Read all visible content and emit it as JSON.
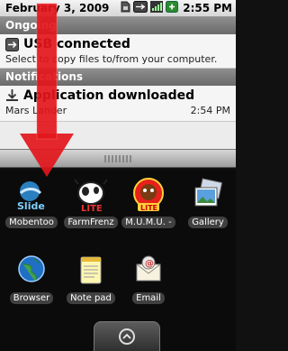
{
  "status_bar": {
    "date": "February 3, 2009",
    "time": "2:55 PM",
    "icons": [
      "sd-card-icon",
      "usb-icon",
      "signal-icon",
      "battery-icon"
    ]
  },
  "shade": {
    "ongoing_header": "Ongoing",
    "usb": {
      "title": "USB connected",
      "subtitle": "Select to copy files to/from your computer."
    },
    "notifications_header": "Notifications",
    "download": {
      "title": "Application downloaded",
      "app": "Mars Lander",
      "time": "2:54 PM"
    }
  },
  "apps_row1": [
    {
      "label": "Mobentoo",
      "icon": "slide-icon"
    },
    {
      "label": "FarmFrenz",
      "icon": "farmfrenzy-icon"
    },
    {
      "label": "M.U.M.U. -",
      "icon": "mumu-lite-icon"
    },
    {
      "label": "Gallery",
      "icon": "gallery-icon"
    }
  ],
  "apps_row2": [
    {
      "label": "Browser",
      "icon": "browser-icon"
    },
    {
      "label": "Note pad",
      "icon": "notepad-icon"
    },
    {
      "label": "Email",
      "icon": "email-icon"
    }
  ],
  "colors": {
    "arrow": "#e3161b",
    "header": "#7a7a7a"
  }
}
